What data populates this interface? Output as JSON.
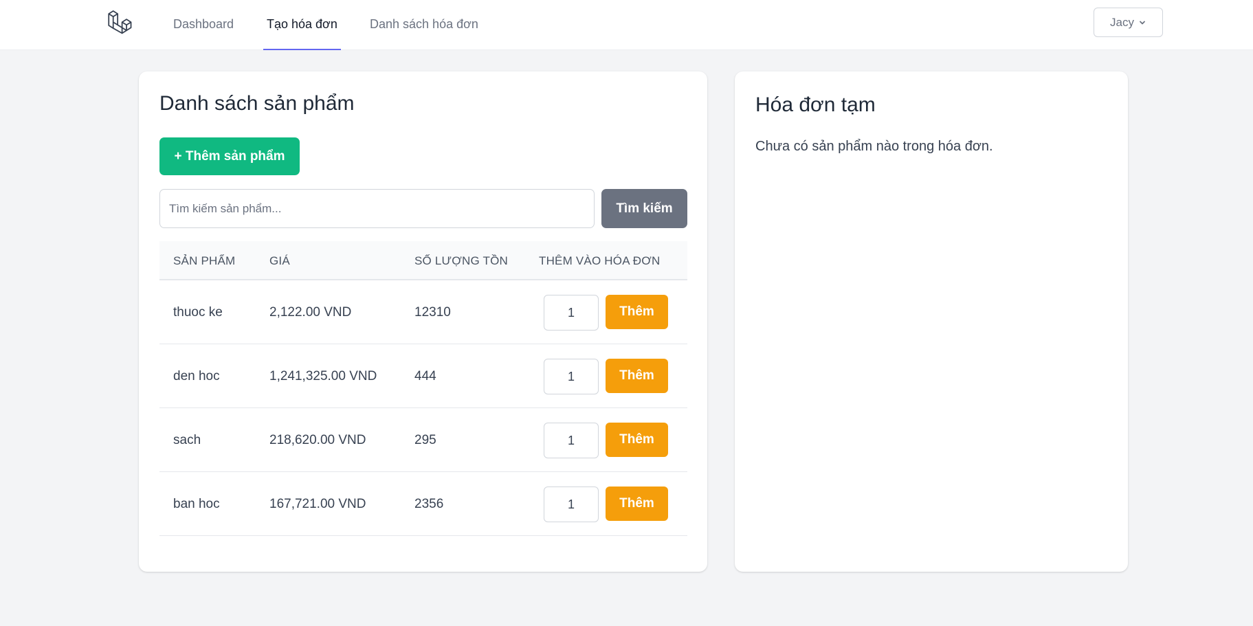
{
  "nav": {
    "links": [
      {
        "label": "Dashboard",
        "active": false
      },
      {
        "label": "Tạo hóa đơn",
        "active": true
      },
      {
        "label": "Danh sách hóa đơn",
        "active": false
      }
    ],
    "user": {
      "name": "Jacy",
      "icon": "chevron-down-icon"
    },
    "logo_icon": "laravel-logo-icon"
  },
  "products": {
    "title": "Danh sách sản phẩm",
    "add_button": "+ Thêm sản phẩm",
    "search": {
      "placeholder": "Tìm kiếm sản phẩm...",
      "value": "",
      "button": "Tìm kiếm"
    },
    "columns": [
      "SẢN PHẨM",
      "GIÁ",
      "SỐ LƯỢNG TỒN",
      "THÊM VÀO HÓA ĐƠN"
    ],
    "rows": [
      {
        "name": "thuoc ke",
        "price": "2,122.00 VND",
        "stock": "12310",
        "qty": "1",
        "action": "Thêm"
      },
      {
        "name": "den hoc",
        "price": "1,241,325.00 VND",
        "stock": "444",
        "qty": "1",
        "action": "Thêm"
      },
      {
        "name": "sach",
        "price": "218,620.00 VND",
        "stock": "295",
        "qty": "1",
        "action": "Thêm"
      },
      {
        "name": "ban hoc",
        "price": "167,721.00 VND",
        "stock": "2356",
        "qty": "1",
        "action": "Thêm"
      }
    ]
  },
  "invoice": {
    "title": "Hóa đơn tạm",
    "empty_message": "Chưa có sản phẩm nào trong hóa đơn."
  },
  "colors": {
    "accent": "#6366f1",
    "add_product": "#10b981",
    "search_button": "#6b7280",
    "row_add": "#f59e0b"
  }
}
